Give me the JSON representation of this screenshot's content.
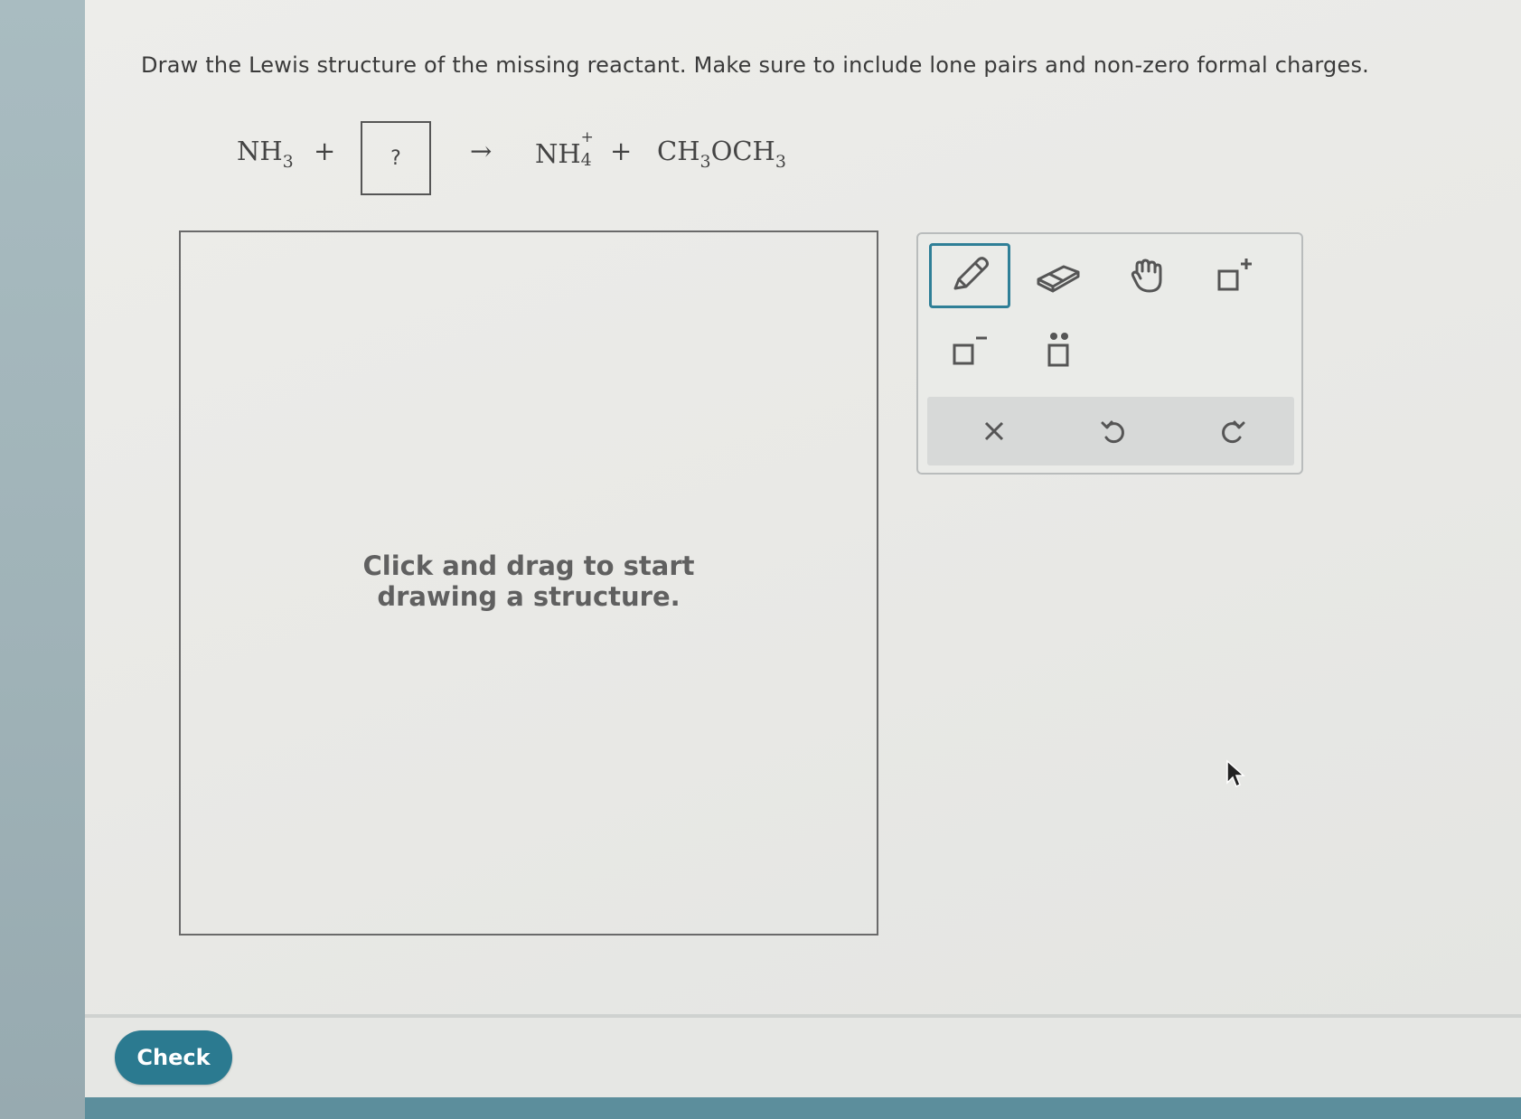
{
  "question": {
    "instructions": "Draw the Lewis structure of the missing reactant. Make sure to include lone pairs and non-zero formal charges."
  },
  "equation": {
    "reactant1": {
      "base": "NH",
      "sub": "3"
    },
    "plus1": "+",
    "unknown": "?",
    "arrow": "→",
    "product1": {
      "base": "NH",
      "sub": "4",
      "sup": "+"
    },
    "plus2": "+",
    "product2": {
      "part1": "CH",
      "sub1": "3",
      "part2": "OCH",
      "sub2": "3"
    }
  },
  "canvas": {
    "hint_line1": "Click and drag to start",
    "hint_line2": "drawing a structure."
  },
  "toolbar": {
    "tools": [
      {
        "name": "pencil-icon",
        "selected": true
      },
      {
        "name": "eraser-icon",
        "selected": false
      },
      {
        "name": "hand-icon",
        "selected": false
      },
      {
        "name": "add-positive-charge-icon",
        "selected": false
      },
      {
        "name": "add-negative-charge-icon",
        "selected": false
      },
      {
        "name": "add-lone-pair-icon",
        "selected": false
      }
    ],
    "actions": [
      "clear-icon",
      "undo-icon",
      "redo-icon"
    ]
  },
  "footer": {
    "check_label": "Check"
  },
  "colors": {
    "accent": "#2b7a90",
    "bottom_bar": "#5c8e9c",
    "text": "#3a3a3a"
  }
}
